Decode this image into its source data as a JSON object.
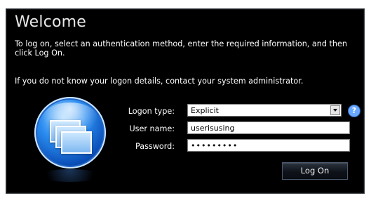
{
  "dialog": {
    "title": "Welcome",
    "instructions": "To log on, select an authentication method, enter the required information, and then click Log On.",
    "note": "If you do not know your logon details, contact your system administrator."
  },
  "form": {
    "logon_type": {
      "label": "Logon type:",
      "value": "Explicit",
      "icon": "help-icon"
    },
    "user_name": {
      "label": "User name:",
      "value": "userisusing"
    },
    "password": {
      "label": "Password:",
      "value": "•••••••••"
    }
  },
  "actions": {
    "log_on_label": "Log On"
  },
  "logo": {
    "icon": "remote-desktop-windows-icon"
  },
  "colors": {
    "panel_bg": "#000000",
    "accent_blue": "#2b8df0"
  }
}
